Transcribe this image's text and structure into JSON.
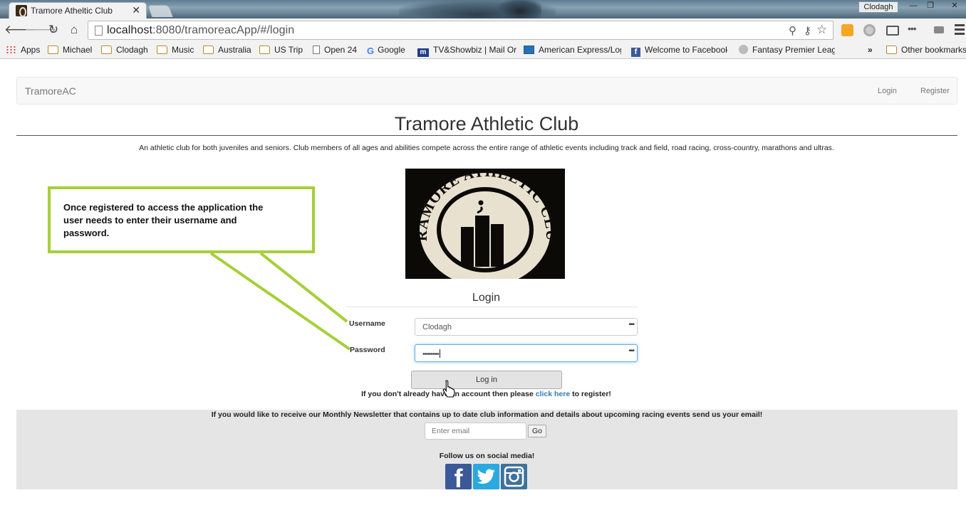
{
  "browser": {
    "tab_title": "Tramore Atheltic Club",
    "tab_close": "✕",
    "profile_name": "Clodagh",
    "window_min": "—",
    "window_max": "❐",
    "window_close": "✕",
    "url_host": "localhost",
    "url_rest": ":8080/tramoreacApp/#/login",
    "bookmarks": [
      {
        "label": "Apps",
        "icon": "apps"
      },
      {
        "label": "Michael",
        "icon": "folder"
      },
      {
        "label": "Clodagh",
        "icon": "folder"
      },
      {
        "label": "Music",
        "icon": "folder"
      },
      {
        "label": "Australia",
        "icon": "folder"
      },
      {
        "label": "US Trip",
        "icon": "folder"
      },
      {
        "label": "Open 24",
        "icon": "page"
      },
      {
        "label": "Google",
        "icon": "google"
      },
      {
        "label": "TV&Showbiz | Mail Or",
        "icon": "dailymail"
      },
      {
        "label": "American Express/Log",
        "icon": "amex"
      },
      {
        "label": "Welcome to Facebook",
        "icon": "facebook"
      },
      {
        "label": "Fantasy Premier Leagu",
        "icon": "premier-league"
      }
    ],
    "bookmarks_overflow": "»",
    "other_bookmarks": "Other bookmarks"
  },
  "navbar": {
    "brand": "TramoreAC",
    "login": "Login",
    "register": "Register"
  },
  "page": {
    "title": "Tramore Athletic Club",
    "intro": "An athletic club for both juveniles and seniors. Club members of all ages and abilities compete across the entire range of athletic events including track and field, road racing, cross-country, marathons and ultras.",
    "logo_text": "TRAMORE ATHLETIC CLUB"
  },
  "login": {
    "heading": "Login",
    "username_label": "Username",
    "username_value": "Clodagh",
    "password_label": "Password",
    "password_value": "••••••••",
    "button": "Log in",
    "register_prefix": "If you don't already have an account then please ",
    "register_link": "click here",
    "register_suffix": " to register!"
  },
  "footer": {
    "newsletter": "If you would like to receive our Monthly Newsletter that contains up to date club information and details about upcoming racing events send us your email!",
    "email_placeholder": "Enter email",
    "go_button": "Go",
    "follow": "Follow us on social media!",
    "facebook_glyph": "f"
  },
  "callout": {
    "text": "Once registered to access the application the user needs to enter their username and password."
  },
  "colors": {
    "callout_border": "#a6cf38",
    "link": "#337ab7",
    "facebook": "#3b5998",
    "twitter": "#2aa9e0",
    "instagram": "#3f729b"
  }
}
